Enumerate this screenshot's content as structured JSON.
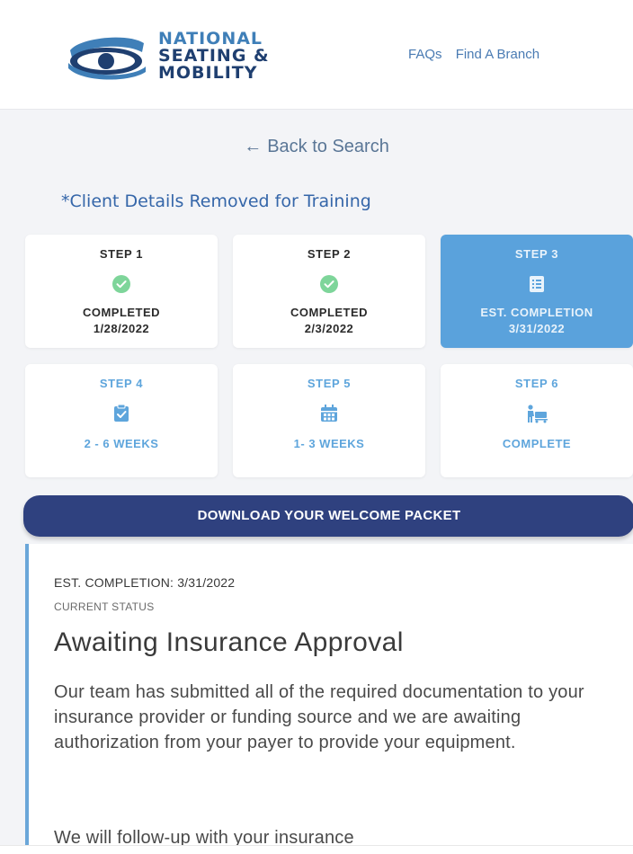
{
  "header": {
    "logo": {
      "line1": "NATIONAL",
      "line2": "SEATING &",
      "line3": "MOBILITY"
    },
    "nav": [
      {
        "label": "FAQs"
      },
      {
        "label": "Find A Branch"
      }
    ]
  },
  "back_link": {
    "arrow": "←",
    "label": "Back to Search"
  },
  "training_note": "*Client Details Removed for Training",
  "steps": [
    {
      "label": "STEP 1",
      "icon": "check-circle-icon",
      "status_line1": "COMPLETED",
      "status_line2": "1/28/2022",
      "state": "done"
    },
    {
      "label": "STEP 2",
      "icon": "check-circle-icon",
      "status_line1": "COMPLETED",
      "status_line2": "2/3/2022",
      "state": "done"
    },
    {
      "label": "STEP 3",
      "icon": "list-document-icon",
      "status_line1": "EST. COMPLETION",
      "status_line2": "3/31/2022",
      "state": "active"
    },
    {
      "label": "STEP 4",
      "icon": "clipboard-check-icon",
      "status_line1": "2 - 6 WEEKS",
      "status_line2": "",
      "state": "future"
    },
    {
      "label": "STEP 5",
      "icon": "calendar-icon",
      "status_line1": "1- 3 WEEKS",
      "status_line2": "",
      "state": "future"
    },
    {
      "label": "STEP 6",
      "icon": "person-delivery-icon",
      "status_line1": "COMPLETE",
      "status_line2": "",
      "state": "future"
    }
  ],
  "download_button": "DOWNLOAD YOUR WELCOME PACKET",
  "status": {
    "est_completion": "EST. COMPLETION: 3/31/2022",
    "current_status_label": "CURRENT STATUS",
    "title": "Awaiting Insurance Approval",
    "description": "Our team has submitted all of the required documentation to your insurance provider or funding source and we are awaiting authorization from your payer to provide your equipment.",
    "followup": "We will follow-up with your insurance"
  },
  "colors": {
    "brand_dark": "#2f417f",
    "brand_light": "#5aa2dc",
    "check_green": "#7ed59a",
    "link_blue": "#4a7bb3"
  }
}
